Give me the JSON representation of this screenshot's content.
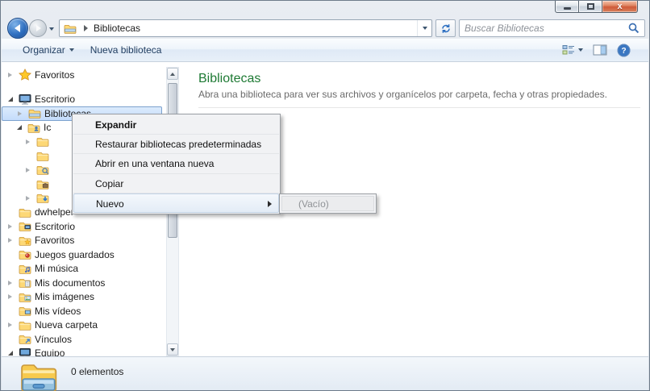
{
  "titlebar": {
    "minimize": "minimize",
    "maximize": "maximize",
    "close": "close"
  },
  "navbar": {
    "breadcrumb": {
      "root_icon": "libraries-icon",
      "location": "Bibliotecas"
    },
    "search": {
      "placeholder": "Buscar Bibliotecas"
    }
  },
  "toolbar": {
    "organize_label": "Organizar",
    "new_library_label": "Nueva biblioteca"
  },
  "sidebar": {
    "items": [
      {
        "label": "Favoritos",
        "icon": "star-icon",
        "expander": "collapsed",
        "level": 0,
        "group_end": true
      },
      {
        "label": "Escritorio",
        "icon": "desktop-icon",
        "expander": "expanded",
        "level": 0
      },
      {
        "label": "Bibliotecas",
        "icon": "libraries-icon",
        "expander": "collapsed",
        "level": 1,
        "selected": true
      },
      {
        "label": "Ic",
        "icon": "user-folder-icon",
        "expander": "expanded",
        "level": 1
      },
      {
        "label": "",
        "icon": "folder-icon",
        "expander": "collapsed",
        "level": 2
      },
      {
        "label": "",
        "icon": "folder-icon",
        "expander": "none",
        "level": 2
      },
      {
        "label": "",
        "icon": "search-folder-icon",
        "expander": "collapsed",
        "level": 2
      },
      {
        "label": "",
        "icon": "case-folder-icon",
        "expander": "none",
        "level": 2
      },
      {
        "label": "",
        "icon": "download-folder-icon",
        "expander": "collapsed",
        "level": 2
      },
      {
        "label": "dwhelper",
        "icon": "folder-icon",
        "expander": "none",
        "level": 0
      },
      {
        "label": "Escritorio",
        "icon": "desktop-folder-icon",
        "expander": "collapsed",
        "level": 0
      },
      {
        "label": "Favoritos",
        "icon": "star-folder-icon",
        "expander": "collapsed",
        "level": 0
      },
      {
        "label": "Juegos guardados",
        "icon": "saved-games-icon",
        "expander": "none",
        "level": 0
      },
      {
        "label": "Mi música",
        "icon": "music-folder-icon",
        "expander": "none",
        "level": 0
      },
      {
        "label": "Mis documentos",
        "icon": "documents-folder-icon",
        "expander": "collapsed",
        "level": 0
      },
      {
        "label": "Mis imágenes",
        "icon": "pictures-folder-icon",
        "expander": "collapsed",
        "level": 0
      },
      {
        "label": "Mis vídeos",
        "icon": "videos-folder-icon",
        "expander": "none",
        "level": 0
      },
      {
        "label": "Nueva carpeta",
        "icon": "folder-icon",
        "expander": "collapsed",
        "level": 0
      },
      {
        "label": "Vínculos",
        "icon": "links-folder-icon",
        "expander": "none",
        "level": 0
      },
      {
        "label": "Equipo",
        "icon": "computer-icon",
        "expander": "expanded",
        "level": 0
      }
    ]
  },
  "main": {
    "title": "Bibliotecas",
    "subtitle": "Abra una biblioteca para ver sus archivos y organícelos por carpeta, fecha y otras propiedades."
  },
  "context_menu": {
    "items": [
      {
        "label": "Expandir",
        "bold": true
      },
      {
        "label": "Restaurar bibliotecas predeterminadas"
      },
      {
        "label": "Abrir en una ventana nueva"
      },
      {
        "label": "Copiar"
      },
      {
        "label": "Nuevo",
        "has_submenu": true,
        "highlighted": true
      }
    ],
    "submenu_items": [
      {
        "label": "(Vacío)",
        "disabled": true
      }
    ]
  },
  "statusbar": {
    "items_count": "0 elementos"
  },
  "colors": {
    "accent_green": "#1e7a34",
    "selection_border": "#7da2ce",
    "selection_fill": "#d0e4fb",
    "close_red": "#cf5a39",
    "toolbar_text": "#1f3c5f"
  }
}
